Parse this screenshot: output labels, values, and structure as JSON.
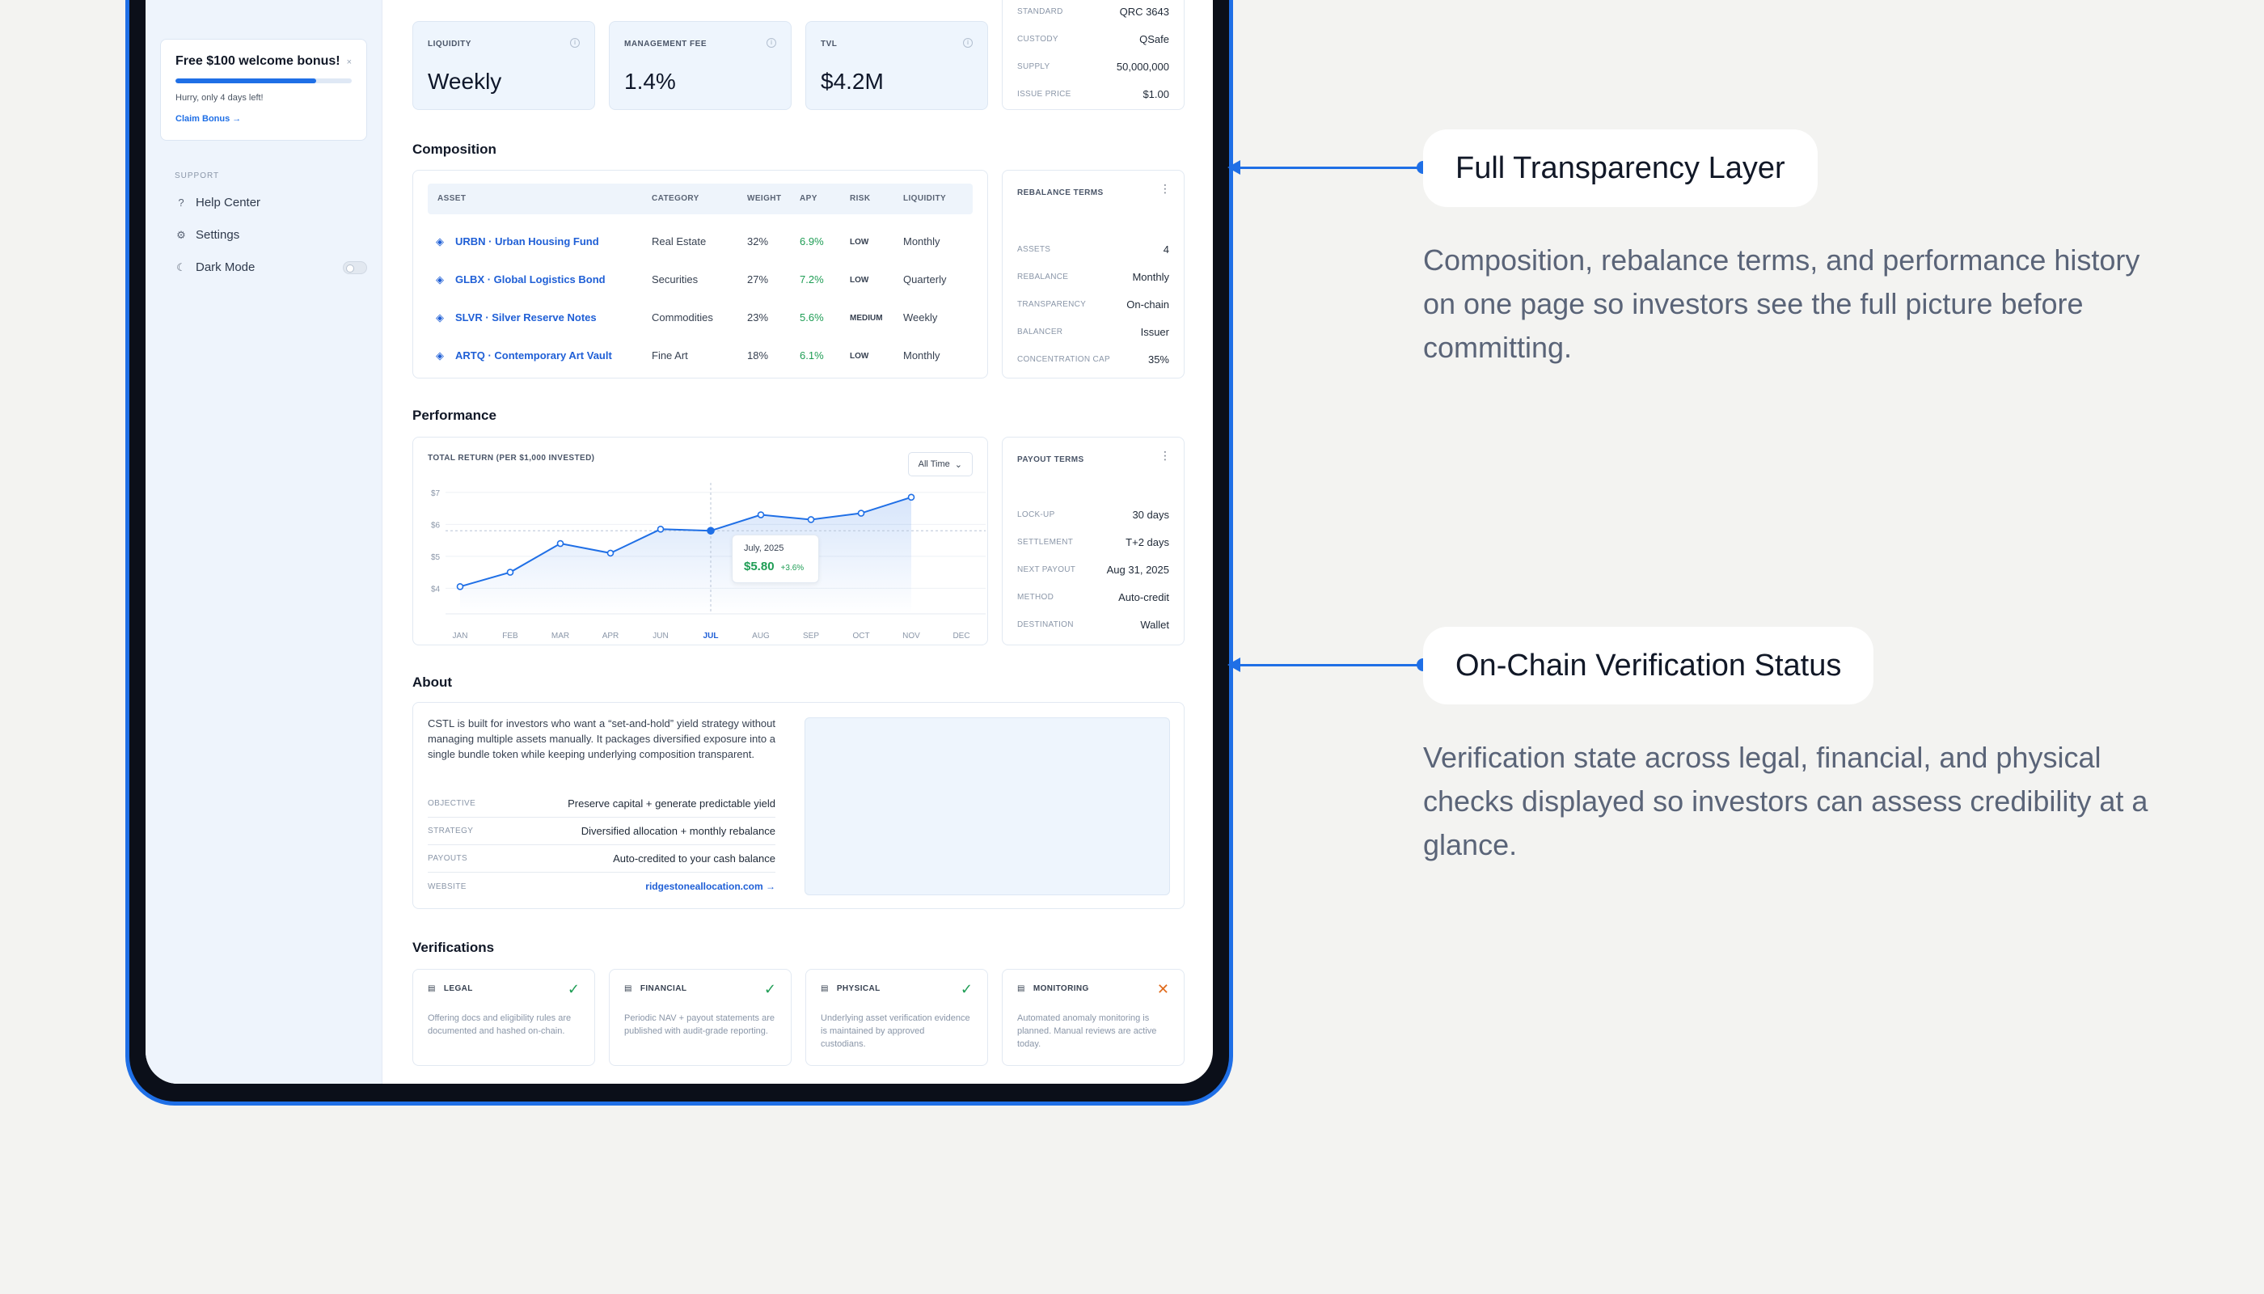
{
  "sidebar": {
    "bonus": {
      "title": "Free $100 welcome bonus!",
      "close": "×",
      "progress": 0.8,
      "subtitle": "Hurry, only 4 days left!",
      "cta": "Claim Bonus →"
    },
    "support_label": "SUPPORT",
    "items": [
      {
        "label": "Help Center",
        "icon": "?"
      },
      {
        "label": "Settings",
        "icon": "⚙"
      },
      {
        "label": "Dark Mode",
        "icon": "☾"
      }
    ]
  },
  "stats": [
    {
      "label": "LIQUIDITY",
      "value": "Weekly"
    },
    {
      "label": "MANAGEMENT FEE",
      "value": "1.4%"
    },
    {
      "label": "TVL",
      "value": "$4.2M"
    }
  ],
  "token_info": [
    {
      "k": "STANDARD",
      "v": "QRC 3643"
    },
    {
      "k": "CUSTODY",
      "v": "QSafe"
    },
    {
      "k": "SUPPLY",
      "v": "50,000,000"
    },
    {
      "k": "ISSUE PRICE",
      "v": "$1.00"
    }
  ],
  "composition": {
    "title": "Composition",
    "headers": [
      "ASSET",
      "CATEGORY",
      "WEIGHT",
      "APY",
      "RISK",
      "LIQUIDITY"
    ],
    "rows": [
      {
        "asset": "URBN · Urban Housing Fund",
        "category": "Real Estate",
        "weight": "32%",
        "apy": "6.9%",
        "risk": "LOW",
        "liquidity": "Monthly"
      },
      {
        "asset": "GLBX · Global Logistics Bond",
        "category": "Securities",
        "weight": "27%",
        "apy": "7.2%",
        "risk": "LOW",
        "liquidity": "Quarterly"
      },
      {
        "asset": "SLVR · Silver Reserve Notes",
        "category": "Commodities",
        "weight": "23%",
        "apy": "5.6%",
        "risk": "MEDIUM",
        "liquidity": "Weekly"
      },
      {
        "asset": "ARTQ · Contemporary Art Vault",
        "category": "Fine Art",
        "weight": "18%",
        "apy": "6.1%",
        "risk": "LOW",
        "liquidity": "Monthly"
      }
    ]
  },
  "rebalance": {
    "title": "REBALANCE TERMS",
    "items": [
      {
        "k": "ASSETS",
        "v": "4"
      },
      {
        "k": "REBALANCE",
        "v": "Monthly"
      },
      {
        "k": "TRANSPARENCY",
        "v": "On-chain"
      },
      {
        "k": "BALANCER",
        "v": "Issuer"
      },
      {
        "k": "CONCENTRATION CAP",
        "v": "35%"
      }
    ]
  },
  "performance": {
    "title": "Performance",
    "chart_label": "TOTAL RETURN (PER $1,000 INVESTED)",
    "range": "All Time",
    "tooltip": {
      "date": "July, 2025",
      "value": "$5.80",
      "change": "+3.6%"
    }
  },
  "chart_data": {
    "type": "line",
    "categories": [
      "JAN",
      "FEB",
      "MAR",
      "APR",
      "JUN",
      "JUL",
      "AUG",
      "SEP",
      "OCT",
      "NOV",
      "DEC"
    ],
    "series": [
      {
        "values": [
          4.05,
          4.5,
          5.4,
          5.1,
          5.85,
          5.8,
          6.3,
          6.15,
          6.35,
          6.85
        ]
      }
    ],
    "yticks": [
      "$7",
      "$6",
      "$5",
      "$4"
    ],
    "ylim": [
      3.4,
      7.2
    ],
    "highlight": "JUL",
    "grid": true
  },
  "payout": {
    "title": "PAYOUT TERMS",
    "items": [
      {
        "k": "LOCK-UP",
        "v": "30 days"
      },
      {
        "k": "SETTLEMENT",
        "v": "T+2 days"
      },
      {
        "k": "NEXT PAYOUT",
        "v": "Aug 31, 2025"
      },
      {
        "k": "METHOD",
        "v": "Auto-credit"
      },
      {
        "k": "DESTINATION",
        "v": "Wallet"
      }
    ]
  },
  "about": {
    "title": "About",
    "text": "CSTL is built for investors who want a “set-and-hold” yield strategy without managing multiple assets manually. It packages diversified exposure into a single bundle token while keeping underlying composition transparent.",
    "rows": [
      {
        "k": "OBJECTIVE",
        "v": "Preserve capital + generate predictable yield"
      },
      {
        "k": "STRATEGY",
        "v": "Diversified allocation + monthly rebalance"
      },
      {
        "k": "PAYOUTS",
        "v": "Auto-credited to your cash balance"
      },
      {
        "k": "WEBSITE",
        "v": "ridgestoneallocation.com →"
      }
    ]
  },
  "verifications": {
    "title": "Verifications",
    "items": [
      {
        "label": "LEGAL",
        "status": "✓",
        "desc": "Offering docs and eligibility rules are documented and hashed on-chain."
      },
      {
        "label": "FINANCIAL",
        "status": "✓",
        "desc": "Periodic NAV + payout statements are published with audit-grade reporting."
      },
      {
        "label": "PHYSICAL",
        "status": "✓",
        "desc": "Underlying asset verification evidence is maintained by approved custodians."
      },
      {
        "label": "MONITORING",
        "status": "✕",
        "desc": "Automated anomaly monitoring is planned. Manual reviews are active today."
      }
    ]
  },
  "callouts": [
    {
      "title": "Full Transparency Layer",
      "desc": "Composition, rebalance terms, and performance history on one page so investors see the full picture before committing."
    },
    {
      "title": "On-Chain Verification Status",
      "desc": "Verification state across legal, financial, and physical checks displayed so investors can assess credibility at a glance."
    }
  ],
  "colors": {
    "accent": "#1f6fe6",
    "positive": "#1f9d55",
    "warning": "#e07b12"
  }
}
